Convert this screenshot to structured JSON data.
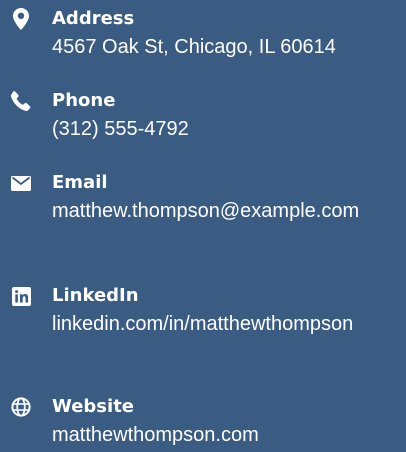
{
  "contact": {
    "items": [
      {
        "icon": "map-marker-icon",
        "label": "Address",
        "value": "4567 Oak St, Chicago, IL 60614"
      },
      {
        "icon": "phone-icon",
        "label": "Phone",
        "value": "(312) 555-4792"
      },
      {
        "icon": "envelope-icon",
        "label": "Email",
        "value": "matthew.thompson@example.com"
      },
      {
        "icon": "linkedin-icon",
        "label": "LinkedIn",
        "value": "linkedin.com/in/matthewthompson"
      },
      {
        "icon": "globe-icon",
        "label": "Website",
        "value": "matthewthompson.com"
      }
    ]
  },
  "colors": {
    "background": "#3a5b82",
    "text": "#ffffff"
  }
}
